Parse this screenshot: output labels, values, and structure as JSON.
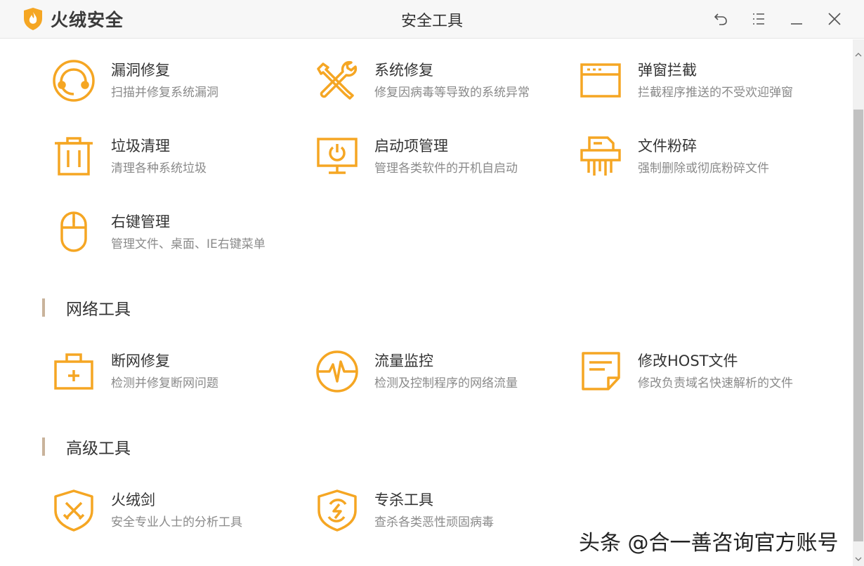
{
  "app": {
    "name": "火绒安全",
    "window_title": "安全工具"
  },
  "controls": {
    "back": "back-arrow-icon",
    "menu": "menu-list-icon",
    "minimize": "minimize-icon",
    "close": "close-icon"
  },
  "colors": {
    "accent": "#f5a623",
    "section_bar": "#c9b39b"
  },
  "system_tools": [
    {
      "name": "漏洞修复",
      "desc": "扫描并修复系统漏洞",
      "icon": "vulnerability-repair-icon"
    },
    {
      "name": "系统修复",
      "desc": "修复因病毒等导致的系统异常",
      "icon": "wrench-screwdriver-icon"
    },
    {
      "name": "弹窗拦截",
      "desc": "拦截程序推送的不受欢迎弹窗",
      "icon": "popup-window-icon"
    },
    {
      "name": "垃圾清理",
      "desc": "清理各种系统垃圾",
      "icon": "trash-can-icon"
    },
    {
      "name": "启动项管理",
      "desc": "管理各类软件的开机自启动",
      "icon": "monitor-power-icon"
    },
    {
      "name": "文件粉碎",
      "desc": "强制删除或彻底粉碎文件",
      "icon": "shredder-icon"
    },
    {
      "name": "右键管理",
      "desc": "管理文件、桌面、IE右键菜单",
      "icon": "mouse-icon"
    }
  ],
  "sections": {
    "network": {
      "title": "网络工具",
      "tools": [
        {
          "name": "断网修复",
          "desc": "检测并修复断网问题",
          "icon": "first-aid-kit-icon"
        },
        {
          "name": "流量监控",
          "desc": "检测及控制程序的网络流量",
          "icon": "pulse-monitor-icon"
        },
        {
          "name": "修改HOST文件",
          "desc": "修改负责域名快速解析的文件",
          "icon": "note-file-icon"
        }
      ]
    },
    "advanced": {
      "title": "高级工具",
      "tools": [
        {
          "name": "火绒剑",
          "desc": "安全专业人士的分析工具",
          "icon": "crossed-swords-shield-icon"
        },
        {
          "name": "专杀工具",
          "desc": "查杀各类恶性顽固病毒",
          "icon": "lightning-shield-icon"
        }
      ]
    }
  },
  "watermark": "头条 @合一善咨询官方账号"
}
